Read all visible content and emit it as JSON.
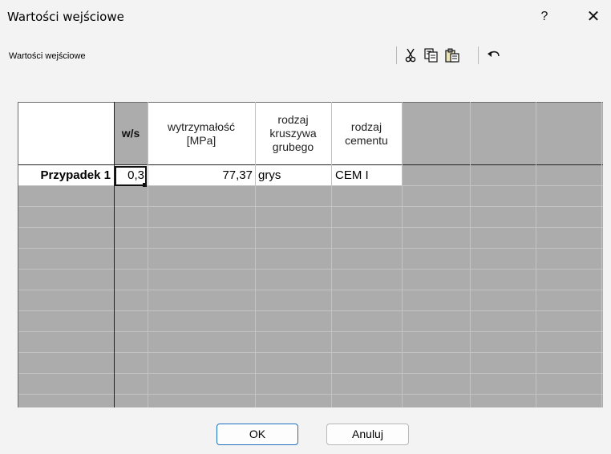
{
  "window": {
    "title": "Wartości wejściowe",
    "help_label": "?",
    "close_label": "✕"
  },
  "group": {
    "label": "Wartości wejściowe"
  },
  "toolbar": {
    "icons": [
      "scissors-icon",
      "copy-icon",
      "paste-icon",
      "undo-icon"
    ]
  },
  "table": {
    "headers": {
      "ws": "w/s",
      "strength": [
        "wytrzymałość",
        "[MPa]"
      ],
      "aggregate": [
        "rodzaj",
        "kruszywa",
        "grubego"
      ],
      "cement": [
        "rodzaj",
        "cementu"
      ]
    },
    "rows": [
      {
        "label": "Przypadek 1",
        "ws": "0,3",
        "strength": "77,37",
        "aggregate": "grys",
        "cement": "CEM I"
      }
    ]
  },
  "buttons": {
    "ok": "OK",
    "cancel": "Anuluj"
  }
}
